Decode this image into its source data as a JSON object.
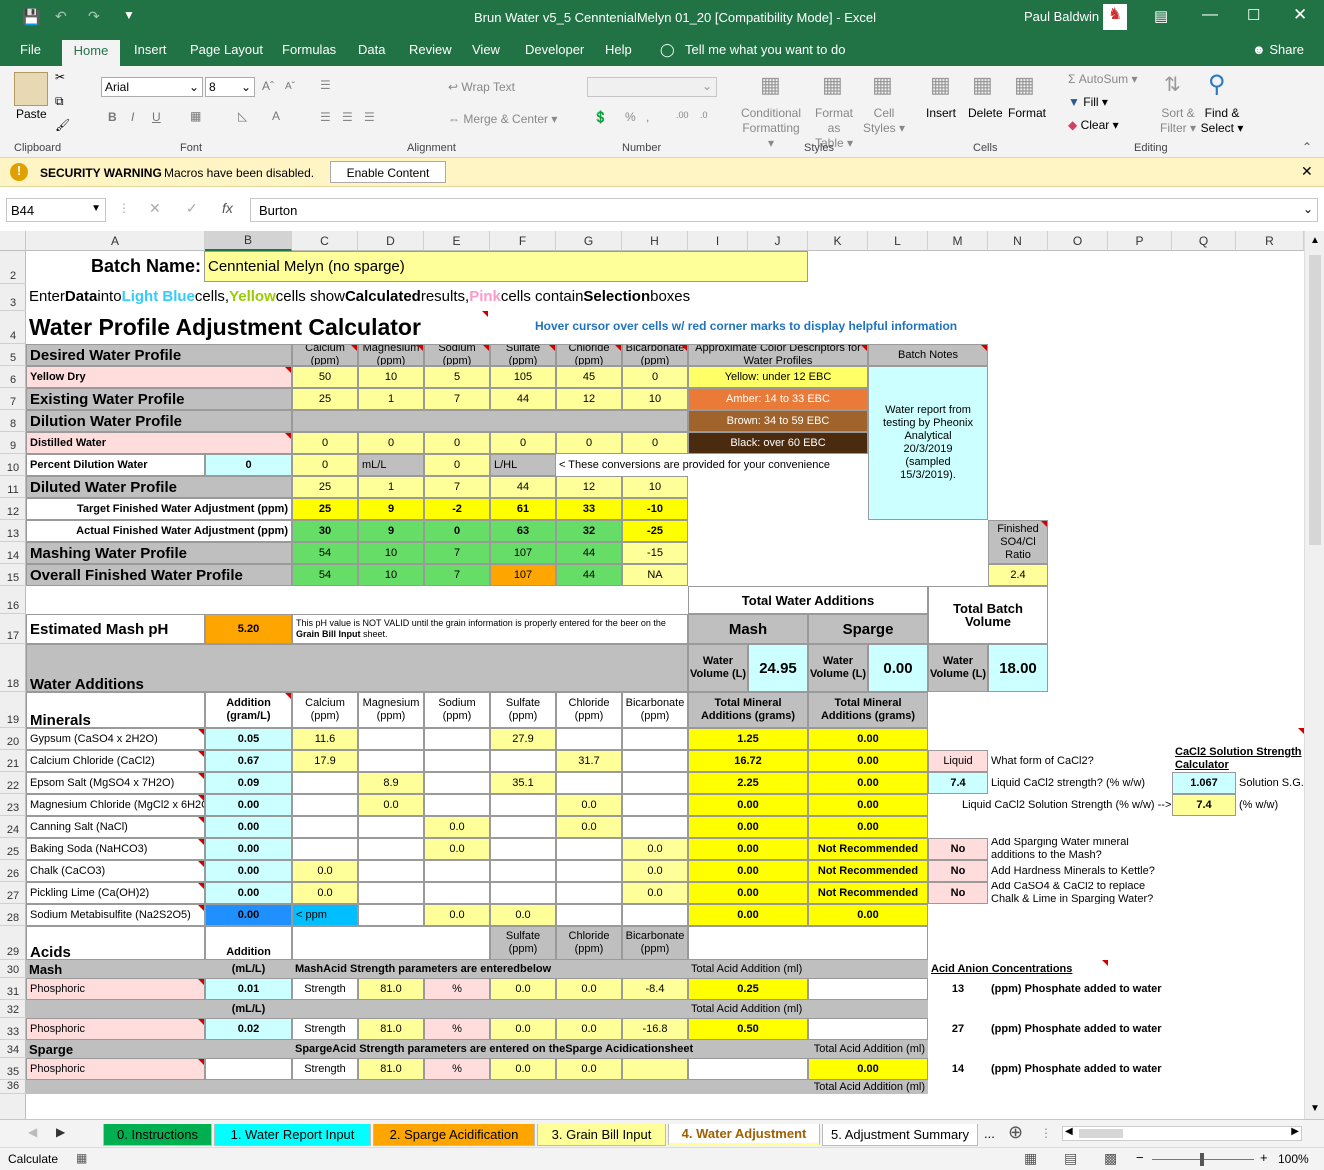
{
  "window": {
    "title": "Brun Water v5_5 CenntenialMelyn 01_20  [Compatibility Mode]  -  Excel",
    "user": "Paul Baldwin"
  },
  "menu": {
    "items": [
      "File",
      "Home",
      "Insert",
      "Page Layout",
      "Formulas",
      "Data",
      "Review",
      "View",
      "Developer",
      "Help"
    ],
    "tell": "Tell me what you want to do",
    "share": "Share"
  },
  "ribbon": {
    "paste": "Paste",
    "clipboard": "Clipboard",
    "font_name": "Arial",
    "font_size": "8",
    "font": "Font",
    "wrap": "Wrap Text",
    "merge": "Merge & Center",
    "alignment": "Alignment",
    "number": "Number",
    "cond1": "Conditional",
    "cond2": "Formatting",
    "fmt1": "Format as",
    "fmt2": "Table",
    "cell1": "Cell",
    "cell2": "Styles",
    "styles": "Styles",
    "insert": "Insert",
    "delete": "Delete",
    "format": "Format",
    "cells": "Cells",
    "autosum": "AutoSum",
    "fill": "Fill",
    "clear": "Clear",
    "sort1": "Sort &",
    "sort2": "Filter",
    "find1": "Find &",
    "find2": "Select",
    "editing": "Editing"
  },
  "security": {
    "label": "SECURITY WARNING",
    "msg": "Macros have been disabled.",
    "button": "Enable Content"
  },
  "formula": {
    "namebox": "B44",
    "value": "Burton"
  },
  "columns": [
    "A",
    "B",
    "C",
    "D",
    "E",
    "F",
    "G",
    "H",
    "I",
    "J",
    "K",
    "L",
    "M",
    "N",
    "O",
    "P",
    "Q",
    "R"
  ],
  "rows": [
    "2",
    "3",
    "4",
    "5",
    "6",
    "7",
    "8",
    "9",
    "10",
    "11",
    "12",
    "13",
    "14",
    "15",
    "16",
    "17",
    "18",
    "19",
    "20",
    "21",
    "22",
    "23",
    "24",
    "25",
    "26",
    "27",
    "28",
    "29",
    "30",
    "31",
    "32",
    "33",
    "34",
    "35",
    "36"
  ],
  "sheet": {
    "batch_label": "Batch Name:",
    "batch_value": "Cenntenial Melyn (no sparge)",
    "intro": {
      "p1": "Enter ",
      "p2": "Data",
      "p3": " into ",
      "p4": "Light Blue",
      "p5": " cells, ",
      "p6": "Yellow",
      "p7": " cells show ",
      "p8": "Calculated",
      "p9": " results, ",
      "p10": "Pink",
      "p11": " cells contain ",
      "p12": "Selection",
      "p13": " boxes"
    },
    "title": "Water Profile Adjustment Calculator",
    "hover": "Hover cursor over cells w/ red corner marks to display helpful information",
    "ions": [
      "Calcium\n(ppm)",
      "Magnesium\n(ppm)",
      "Sodium\n(ppm)",
      "Sulfate\n(ppm)",
      "Chloride\n(ppm)",
      "Bicarbonate\n(ppm)"
    ],
    "color_hdr": "Approximate Color Descriptors for Water Profiles",
    "batch_notes": "Batch Notes",
    "colors": [
      "Yellow: under 12 EBC",
      "Amber: 14 to 33 EBC",
      "Brown: 34 to 59 EBC",
      "Black: over 60 EBC"
    ],
    "notes": "Water report from testing by Pheonix Analytical 20/3/2019 (sampled 15/3/2019).",
    "desired": "Desired Water Profile",
    "yellow_dry": "Yellow Dry",
    "yellow_dry_vals": [
      "50",
      "10",
      "5",
      "105",
      "45",
      "0"
    ],
    "existing": "Existing Water Profile",
    "existing_vals": [
      "25",
      "1",
      "7",
      "44",
      "12",
      "10"
    ],
    "dilution": "Dilution Water Profile",
    "distilled": "Distilled Water",
    "distilled_vals": [
      "0",
      "0",
      "0",
      "0",
      "0",
      "0"
    ],
    "pct_dil": "Percent Dilution Water",
    "pct_val": "0",
    "r10c": "0",
    "r10d": "mL/L",
    "r10e": "0",
    "r10f": "L/HL",
    "r10g": "< These conversions are provided for your convenience",
    "diluted": "Diluted Water Profile",
    "diluted_vals": [
      "25",
      "1",
      "7",
      "44",
      "12",
      "10"
    ],
    "target": "Target Finished Water Adjustment (ppm)",
    "target_vals": [
      "25",
      "9",
      "-2",
      "61",
      "33",
      "-10"
    ],
    "actual": "Actual Finished Water Adjustment (ppm)",
    "actual_vals": [
      "30",
      "9",
      "0",
      "63",
      "32",
      "-25"
    ],
    "mashing": "Mashing Water Profile",
    "mashing_vals": [
      "54",
      "10",
      "7",
      "107",
      "44",
      "-15"
    ],
    "overall": "Overall Finished Water Profile",
    "overall_vals": [
      "54",
      "10",
      "7",
      "107",
      "44",
      "NA"
    ],
    "ratio_hdr": "Finished SO4/Cl Ratio",
    "ratio": "2.4",
    "total_water": "Total Water Additions",
    "total_batch": "Total Batch Volume",
    "mash": "Mash",
    "sparge": "Sparge",
    "est_ph": "Estimated Mash pH",
    "ph": "5.20",
    "ph_note1": "This pH value is NOT VALID until the grain information is properly entered for the beer on the ",
    "ph_note2": "Grain Bill Input",
    "ph_note3": " sheet.",
    "water_vol": "Water Volume (L)",
    "mash_vol": "24.95",
    "sparge_vol": "0.00",
    "batch_vol": "18.00",
    "water_add": "Water Additions",
    "minerals": "Minerals",
    "addition": "Addition (gram/L)",
    "total_min": "Total Mineral Additions (grams)",
    "mineral_rows": [
      {
        "name": "Gypsum (CaSO4 x 2H2O)",
        "add": "0.05",
        "ca": "11.6",
        "mg": "",
        "na": "",
        "so4": "27.9",
        "cl": "",
        "hco3": "",
        "tm": "1.25",
        "ts": "0.00"
      },
      {
        "name": "Calcium Chloride (CaCl2)",
        "add": "0.67",
        "ca": "17.9",
        "mg": "",
        "na": "",
        "so4": "",
        "cl": "31.7",
        "hco3": "",
        "tm": "16.72",
        "ts": "0.00"
      },
      {
        "name": "Epsom Salt (MgSO4 x 7H2O)",
        "add": "0.09",
        "ca": "",
        "mg": "8.9",
        "na": "",
        "so4": "35.1",
        "cl": "",
        "hco3": "",
        "tm": "2.25",
        "ts": "0.00"
      },
      {
        "name": "Magnesium Chloride (MgCl2 x 6H2O)",
        "add": "0.00",
        "ca": "",
        "mg": "0.0",
        "na": "",
        "so4": "",
        "cl": "0.0",
        "hco3": "",
        "tm": "0.00",
        "ts": "0.00"
      },
      {
        "name": "Canning Salt (NaCl)",
        "add": "0.00",
        "ca": "",
        "mg": "",
        "na": "0.0",
        "so4": "",
        "cl": "0.0",
        "hco3": "",
        "tm": "0.00",
        "ts": "0.00"
      },
      {
        "name": "Baking Soda (NaHCO3)",
        "add": "0.00",
        "ca": "",
        "mg": "",
        "na": "0.0",
        "so4": "",
        "cl": "",
        "hco3": "0.0",
        "tm": "0.00",
        "ts": "Not Recommended"
      },
      {
        "name": "Chalk (CaCO3)",
        "add": "0.00",
        "ca": "0.0",
        "mg": "",
        "na": "",
        "so4": "",
        "cl": "",
        "hco3": "0.0",
        "tm": "0.00",
        "ts": "Not Recommended"
      },
      {
        "name": "Pickling Lime (Ca(OH)2)",
        "add": "0.00",
        "ca": "0.0",
        "mg": "",
        "na": "",
        "so4": "",
        "cl": "",
        "hco3": "0.0",
        "tm": "0.00",
        "ts": "Not Recommended"
      },
      {
        "name": "Sodium Metabisulfite (Na2S2O5)",
        "add": "0.00",
        "ca": "< ppm",
        "mg": "",
        "na": "0.0",
        "so4": "0.0",
        "cl": "",
        "hco3": "",
        "tm": "0.00",
        "ts": "0.00"
      }
    ],
    "cacl_liquid": "Liquid",
    "cacl_q1": "What form of CaCl2?",
    "cacl_str": "7.4",
    "cacl_q2": "Liquid CaCl2 strength? (% w/w)",
    "cacl_q3": "Liquid CaCl2 Solution Strength (% w/w) -->",
    "calc_title": "CaCl2 Solution Strength Calculator",
    "sg_val": "1.067",
    "sg_lbl": "Solution S.G.",
    "ww_val": "7.4",
    "ww_lbl": "(% w/w)",
    "no1": "No",
    "q25": "Add Sparging Water mineral additions to the Mash?",
    "no2": "No",
    "q26": "Add Hardness Minerals to Kettle?",
    "no3": "No",
    "q27": "Add CaSO4 & CaCl2 to replace Chalk & Lime in Sparging Water?",
    "acids": "Acids",
    "acid_addition": "Addition",
    "acid_ions": [
      "Sulfate\n(ppm)",
      "Chloride\n(ppm)",
      "Bicarbonate\n(ppm)"
    ],
    "mash_lbl": "Mash",
    "mll": "(mL/L)",
    "mash_param1": "Mash",
    "mash_param2": " Acid Strength parameters are entered ",
    "mash_param3": "below",
    "total_acid": "Total Acid Addition (ml)",
    "anion": "Acid Anion Concentrations",
    "acid1": {
      "name": "Phosphoric",
      "add": "0.01",
      "strength": "Strength",
      "sv": "81.0",
      "pct": "%",
      "so4": "0.0",
      "cl": "0.0",
      "hco3": "-8.4",
      "total": "0.25",
      "ppm": "13",
      "note": "(ppm) Phosphate added to water"
    },
    "mll2": "(mL/L)",
    "total_acid2": "Total Acid Addition (ml)",
    "acid2": {
      "name": "Phosphoric",
      "add": "0.02",
      "strength": "Strength",
      "sv": "81.0",
      "pct": "%",
      "so4": "0.0",
      "cl": "0.0",
      "hco3": "-16.8",
      "total": "0.50",
      "ppm": "27",
      "note": "(ppm) Phosphate added to water"
    },
    "sparge_lbl": "Sparge",
    "sparge_param1": "Sparge",
    "sparge_param2": " Acid Strength parameters are entered on the ",
    "sparge_param3": "Sparge Acidication",
    "sparge_param4": " sheet",
    "total_acid3": "Total Acid Addition (ml)",
    "acid3": {
      "name": "Phosphoric",
      "strength": "Strength",
      "sv": "81.0",
      "pct": "%",
      "so4": "0.0",
      "cl": "0.0",
      "total": "0.00",
      "ppm": "14",
      "note": "(ppm) Phosphate added to water"
    },
    "total_acid4": "Total Acid Addition (ml)"
  },
  "sheet_tabs": [
    "0. Instructions",
    "1. Water Report Input",
    "2. Sparge Acidification",
    "3. Grain Bill Input",
    "4. Water Adjustment",
    "5. Adjustment Summary"
  ],
  "sheet_tab_colors": [
    "#00b050",
    "#00ffff",
    "#ffa500",
    "#ffff99",
    "#ffff99",
    "#ffffff"
  ],
  "more_tabs": "...",
  "status": {
    "mode": "Calculate",
    "zoom": "100%"
  }
}
